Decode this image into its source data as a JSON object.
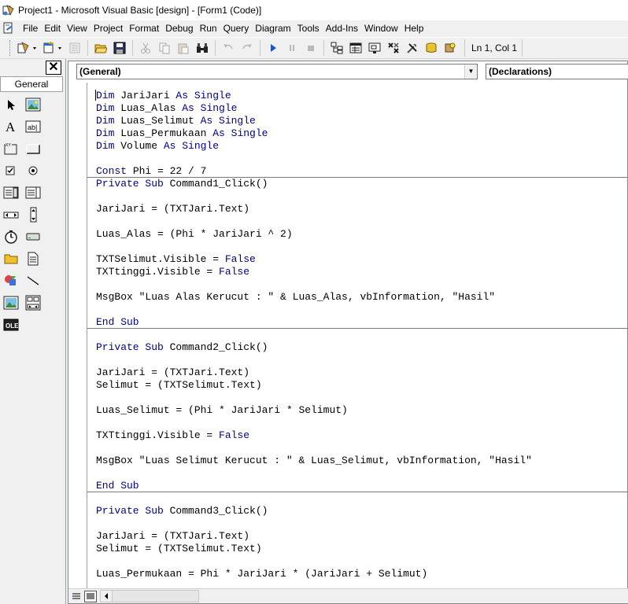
{
  "window": {
    "title": "Project1 - Microsoft Visual Basic [design] - [Form1 (Code)]"
  },
  "menu": [
    "File",
    "Edit",
    "View",
    "Project",
    "Format",
    "Debug",
    "Run",
    "Query",
    "Diagram",
    "Tools",
    "Add-Ins",
    "Window",
    "Help"
  ],
  "status": {
    "position": "Ln 1, Col 1"
  },
  "toolbox": {
    "tab_label": "General",
    "close_glyph": "✕"
  },
  "editor": {
    "object_combo": "(General)",
    "procedure_combo": "(Declarations)",
    "lines": [
      {
        "type": "mix",
        "parts": [
          [
            "kw",
            "Dim"
          ],
          [
            "t",
            " JariJari "
          ],
          [
            "kw",
            "As Single"
          ]
        ]
      },
      {
        "type": "mix",
        "parts": [
          [
            "kw",
            "Dim"
          ],
          [
            "t",
            " Luas_Alas "
          ],
          [
            "kw",
            "As Single"
          ]
        ]
      },
      {
        "type": "mix",
        "parts": [
          [
            "kw",
            "Dim"
          ],
          [
            "t",
            " Luas_Selimut "
          ],
          [
            "kw",
            "As Single"
          ]
        ]
      },
      {
        "type": "mix",
        "parts": [
          [
            "kw",
            "Dim"
          ],
          [
            "t",
            " Luas_Permukaan "
          ],
          [
            "kw",
            "As Single"
          ]
        ]
      },
      {
        "type": "mix",
        "parts": [
          [
            "kw",
            "Dim"
          ],
          [
            "t",
            " Volume "
          ],
          [
            "kw",
            "As Single"
          ]
        ]
      },
      {
        "type": "blank"
      },
      {
        "type": "mix",
        "parts": [
          [
            "kw",
            "Const"
          ],
          [
            "t",
            " Phi = 22 / 7"
          ]
        ]
      },
      {
        "type": "sep"
      },
      {
        "type": "mix",
        "parts": [
          [
            "kw",
            "Private Sub"
          ],
          [
            "t",
            " Command1_Click()"
          ]
        ]
      },
      {
        "type": "blank"
      },
      {
        "type": "mix",
        "parts": [
          [
            "t",
            "JariJari = (TXTJari.Text)"
          ]
        ]
      },
      {
        "type": "blank"
      },
      {
        "type": "mix",
        "parts": [
          [
            "t",
            "Luas_Alas = (Phi * JariJari ^ 2)"
          ]
        ]
      },
      {
        "type": "blank"
      },
      {
        "type": "mix",
        "parts": [
          [
            "t",
            "TXTSelimut.Visible = "
          ],
          [
            "kw",
            "False"
          ]
        ]
      },
      {
        "type": "mix",
        "parts": [
          [
            "t",
            "TXTtinggi.Visible = "
          ],
          [
            "kw",
            "False"
          ]
        ]
      },
      {
        "type": "blank"
      },
      {
        "type": "mix",
        "parts": [
          [
            "t",
            "MsgBox \"Luas Alas Kerucut : \" & Luas_Alas, vbInformation, \"Hasil\""
          ]
        ]
      },
      {
        "type": "blank"
      },
      {
        "type": "mix",
        "parts": [
          [
            "kw",
            "End Sub"
          ]
        ]
      },
      {
        "type": "sep"
      },
      {
        "type": "blank"
      },
      {
        "type": "mix",
        "parts": [
          [
            "kw",
            "Private Sub"
          ],
          [
            "t",
            " Command2_Click()"
          ]
        ]
      },
      {
        "type": "blank"
      },
      {
        "type": "mix",
        "parts": [
          [
            "t",
            "JariJari = (TXTJari.Text)"
          ]
        ]
      },
      {
        "type": "mix",
        "parts": [
          [
            "t",
            "Selimut = (TXTSelimut.Text)"
          ]
        ]
      },
      {
        "type": "blank"
      },
      {
        "type": "mix",
        "parts": [
          [
            "t",
            "Luas_Selimut = (Phi * JariJari * Selimut)"
          ]
        ]
      },
      {
        "type": "blank"
      },
      {
        "type": "mix",
        "parts": [
          [
            "t",
            "TXTtinggi.Visible = "
          ],
          [
            "kw",
            "False"
          ]
        ]
      },
      {
        "type": "blank"
      },
      {
        "type": "mix",
        "parts": [
          [
            "t",
            "MsgBox \"Luas Selimut Kerucut : \" & Luas_Selimut, vbInformation, \"Hasil\""
          ]
        ]
      },
      {
        "type": "blank"
      },
      {
        "type": "mix",
        "parts": [
          [
            "kw",
            "End Sub"
          ]
        ]
      },
      {
        "type": "sep"
      },
      {
        "type": "blank"
      },
      {
        "type": "mix",
        "parts": [
          [
            "kw",
            "Private Sub"
          ],
          [
            "t",
            " Command3_Click()"
          ]
        ]
      },
      {
        "type": "blank"
      },
      {
        "type": "mix",
        "parts": [
          [
            "t",
            "JariJari = (TXTJari.Text)"
          ]
        ]
      },
      {
        "type": "mix",
        "parts": [
          [
            "t",
            "Selimut = (TXTSelimut.Text)"
          ]
        ]
      },
      {
        "type": "blank"
      },
      {
        "type": "mix",
        "parts": [
          [
            "t",
            "Luas_Permukaan = Phi * JariJari * (JariJari + Selimut)"
          ]
        ]
      }
    ]
  },
  "icons": {
    "toolbar": [
      "add-project-icon",
      "add-form-icon",
      "menu-editor-icon",
      "open-icon",
      "save-icon",
      "cut-icon",
      "copy-icon",
      "paste-icon",
      "find-icon",
      "undo-icon",
      "redo-icon",
      "run-icon",
      "break-icon",
      "end-icon",
      "project-explorer-icon",
      "properties-icon",
      "form-layout-icon",
      "object-browser-icon",
      "toolbox-icon",
      "data-view-icon",
      "visual-component-manager-icon"
    ],
    "toolbox": [
      "pointer-icon",
      "picturebox-icon",
      "label-icon",
      "textbox-icon",
      "frame-icon",
      "commandbutton-icon",
      "checkbox-icon",
      "optionbutton-icon",
      "combobox-icon",
      "listbox-icon",
      "hscrollbar-icon",
      "vscrollbar-icon",
      "timer-icon",
      "drivelistbox-icon",
      "dirlistbox-icon",
      "filelistbox-icon",
      "shape-icon",
      "line-icon",
      "image-icon",
      "data-icon",
      "ole-icon"
    ]
  },
  "colors": {
    "keyword": "#00008b",
    "text": "#000000",
    "background": "#ffffff",
    "chrome": "#f0f0f0"
  }
}
